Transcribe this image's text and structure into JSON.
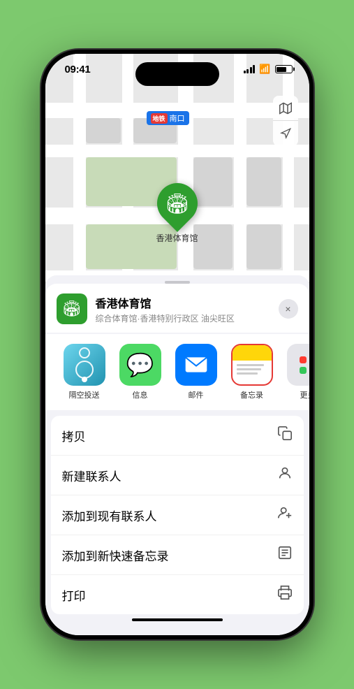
{
  "status": {
    "time": "09:41",
    "location_arrow": "▶"
  },
  "map": {
    "metro_label": "南口",
    "metro_badge": "地铁",
    "marker_label": "香港体育馆"
  },
  "sheet": {
    "location_name": "香港体育馆",
    "location_subtitle": "综合体育馆·香港特别行政区 油尖旺区",
    "close_label": "×"
  },
  "apps": [
    {
      "id": "airdrop",
      "label": "隔空投送"
    },
    {
      "id": "messages",
      "label": "信息"
    },
    {
      "id": "mail",
      "label": "邮件"
    },
    {
      "id": "notes",
      "label": "备忘录"
    },
    {
      "id": "more",
      "label": "更多"
    }
  ],
  "actions": [
    {
      "label": "拷贝",
      "icon": "copy"
    },
    {
      "label": "新建联系人",
      "icon": "person"
    },
    {
      "label": "添加到现有联系人",
      "icon": "person-add"
    },
    {
      "label": "添加到新快速备忘录",
      "icon": "note"
    },
    {
      "label": "打印",
      "icon": "print"
    }
  ]
}
